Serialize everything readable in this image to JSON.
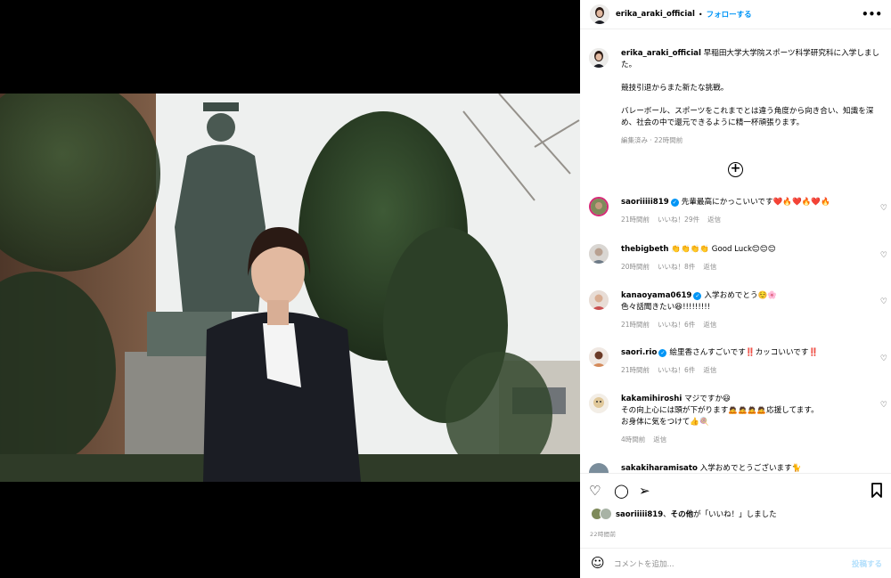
{
  "header": {
    "username": "erika_araki_official",
    "separator": "•",
    "follow_label": "フォローする",
    "more_icon": "more-horizontal-icon"
  },
  "caption": {
    "username": "erika_araki_official",
    "line1": "早稲田大学大学院スポーツ科学研究科に入学しました。",
    "line2": "競技引退からまた新たな挑戦。",
    "line3": "バレーボール、スポーツをこれまでとは違う角度から向き合い、知識を深め、社会の中で還元できるように精一杯頑張ります。",
    "meta": "編集済み · 22時間前"
  },
  "comments": [
    {
      "username": "saoriiiii819",
      "verified": true,
      "text": "先輩最高にかっこいいです❤️🔥❤️🔥❤️🔥",
      "time": "21時間前",
      "likes": "いいね！29件",
      "reply": "返信"
    },
    {
      "username": "thebigbeth",
      "verified": false,
      "text": "👏👏👏👏 Good Luck😊😊😊",
      "time": "20時間前",
      "likes": "いいね！8件",
      "reply": "返信"
    },
    {
      "username": "kanaoyama0619",
      "verified": true,
      "text": "入学おめでとう☺️🌸\n色々話聞きたい😆!!!!!!!!!",
      "time": "21時間前",
      "likes": "いいね！6件",
      "reply": "返信"
    },
    {
      "username": "saori.rio",
      "verified": true,
      "text": "絵里香さんすごいです‼️カッコいいです‼️",
      "time": "21時間前",
      "likes": "いいね！6件",
      "reply": "返信"
    },
    {
      "username": "kakamihiroshi",
      "verified": false,
      "text": "マジですか😃\nその向上心には頭が下がります🙇🙇🙇🙇応援してます。\nお身体に気をつけて👍🍭",
      "time": "4時間前",
      "likes": "",
      "reply": "返信"
    },
    {
      "username": "sakakiharamisato",
      "verified": false,
      "text": "入学おめでとうございます🐈",
      "time": "",
      "likes": "",
      "reply": ""
    }
  ],
  "actions": {
    "like_icon": "heart-icon",
    "comment_icon": "comment-icon",
    "share_icon": "share-icon",
    "save_icon": "bookmark-icon"
  },
  "likes": {
    "user": "saoriiiii819",
    "middle": "、",
    "others": "その他",
    "suffix": "が「いいね！」しました"
  },
  "timestamp": "22時間前",
  "comment_input": {
    "placeholder": "コメントを追加...",
    "post_label": "投稿する",
    "emoji_icon": "emoji-icon"
  },
  "colors": {
    "accent": "#0095f6",
    "muted": "#8e8e8e",
    "post_disabled": "#b2dffc"
  }
}
